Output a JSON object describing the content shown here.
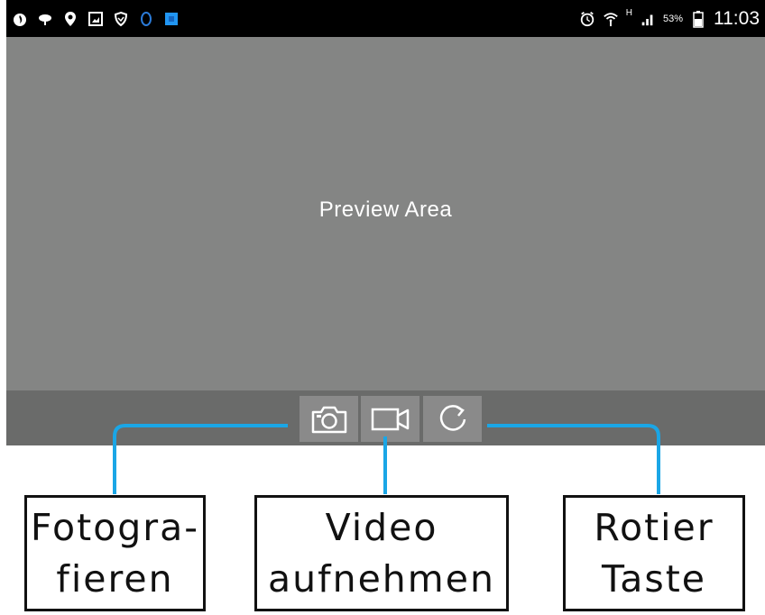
{
  "status_bar": {
    "left_icons": [
      "flame-icon",
      "cloud-icon",
      "location-pin-icon",
      "image-icon",
      "shield-icon",
      "qq-penguin-icon",
      "app-square-icon"
    ],
    "right_icons": [
      "alarm-clock-icon",
      "wifi-icon",
      "signal-icon",
      "battery-icon"
    ],
    "network_type": "H",
    "battery_percent": "53%",
    "time": "11:03",
    "colors": {
      "background": "#000000",
      "foreground": "#ffffff",
      "qq_icon": "#2b7bd8",
      "app_square": "#2196f3"
    }
  },
  "preview": {
    "label": "Preview Area",
    "background": "#848584"
  },
  "toolbar": {
    "background": "#6a6b6a",
    "buttons": [
      {
        "icon": "camera-icon"
      },
      {
        "icon": "video-camera-icon"
      },
      {
        "icon": "rotate-icon"
      }
    ]
  },
  "callouts": {
    "line_color": "#1aa6e6",
    "photo": {
      "line1": "Fotogra-",
      "line2": "fieren"
    },
    "video": {
      "line1": "Video",
      "line2": "aufnehmen"
    },
    "rotate": {
      "line1": "Rotier",
      "line2": "Taste"
    }
  }
}
